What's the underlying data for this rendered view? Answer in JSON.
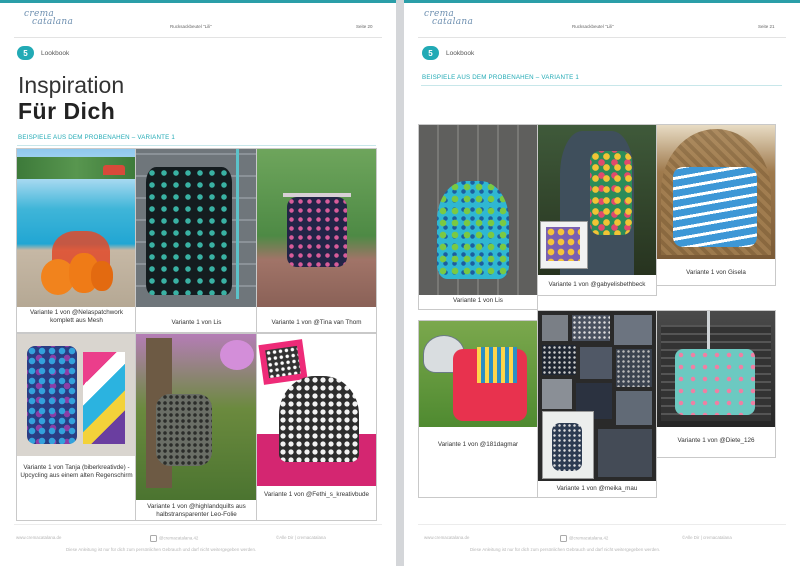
{
  "logo": {
    "line1": "crema",
    "line2": "catalana"
  },
  "left_page": {
    "header_title": "Rucksackbeutel \"Lili\"",
    "page_label": "Seite 20",
    "section_number": "5",
    "section_label": "Lookbook",
    "heading_light": "Inspiration",
    "heading_bold": "Für Dich",
    "subtitle": "BEISPIELE AUS DEM PROBENAHEN – VARIANTE 1",
    "captions": [
      "Variante 1 von @Nelaspatchwork komplett aus Mesh",
      "Variante 1 von Lis",
      "Variante 1 von @Tina van Thom",
      "Variante 1 von Tanja (biberkreativde) - Upcycling aus einem alten Regenschirm",
      "Variante 1 von @highlandquilts aus halbstransparenter Leo-Folie",
      "Variante 1 von @Fethi_s_kreativbude"
    ],
    "footer_url": "www.cremacatalana.de",
    "footer_insta": "@cremacatalana.42",
    "footer_copyright": "©Alle Dir | cremacatalana",
    "footer_notice": "Diese Anleitung ist nur für dich zum persönlichen Gebrauch und darf nicht weitergegeben werden."
  },
  "right_page": {
    "header_title": "Rucksackbeutel \"Lili\"",
    "page_label": "Seite 21",
    "section_number": "5",
    "section_label": "Lookbook",
    "subtitle": "BEISPIELE AUS DEM PROBENAHEN – VARIANTE 1",
    "captions": [
      "Variante 1 von Lis",
      "Variante 1 von @gabyelisbethbeck",
      "Variante 1 von Gisela",
      "Variante 1 von @181dagmar",
      "Variante 1 von @meika_mau",
      "Variante 1 von @Diete_126"
    ],
    "footer_url": "www.cremacatalana.de",
    "footer_insta": "@cremacatalana.42",
    "footer_copyright": "©Alle Dir | cremacatalana",
    "footer_notice": "Diese Anleitung ist nur für dich zum persönlichen Gebrauch und darf nicht weitergegeben werden."
  },
  "colors": {
    "accent": "#22aab5",
    "topbar": "#2a9ea8",
    "logo": "#6d8fb0"
  }
}
